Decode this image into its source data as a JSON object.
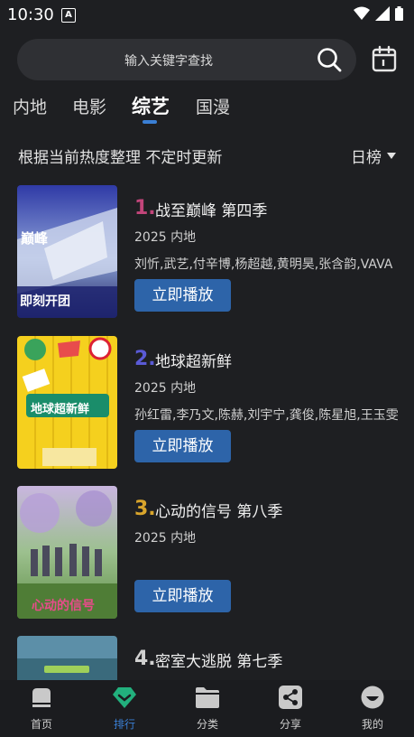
{
  "status_bar": {
    "time": "10:30",
    "notification_letter": "A"
  },
  "search": {
    "placeholder": "输入关键字查找"
  },
  "tabs": [
    {
      "label": "内地"
    },
    {
      "label": "电影"
    },
    {
      "label": "综艺",
      "active": true
    },
    {
      "label": "国漫"
    }
  ],
  "subheader": {
    "text": "根据当前热度整理 不定时更新",
    "ranking": "日榜"
  },
  "colors": {
    "accent": "#3a7fd5",
    "play_button": "#2d64a9",
    "rank1": "#c2457a",
    "rank2": "#5a5ad6",
    "rank3": "#d9a52c",
    "rank4": "#d0d0d0"
  },
  "items": [
    {
      "rank": "1.",
      "title": "战至巅峰 第四季",
      "meta": "2025  内地",
      "cast": "刘忻,武艺,付辛博,杨超越,黄明昊,张含韵,VAVA",
      "play": "立即播放",
      "poster_words": [
        "巅峰",
        "即刻开团"
      ]
    },
    {
      "rank": "2.",
      "title": "地球超新鲜",
      "meta": "2025  内地",
      "cast": "孙红雷,李乃文,陈赫,刘宇宁,龚俊,陈星旭,王玉雯",
      "play": "立即播放",
      "poster_words": [
        "地球超新鲜"
      ]
    },
    {
      "rank": "3.",
      "title": "心动的信号 第八季",
      "meta": "2025  内地",
      "cast": "",
      "play": "立即播放",
      "poster_words": [
        "心动的信号"
      ]
    },
    {
      "rank": "4.",
      "title": "密室大逃脱 第七季",
      "meta": "",
      "cast": "",
      "play": "",
      "poster_words": []
    }
  ],
  "bottom_nav": [
    {
      "label": "首页",
      "icon": "home-icon"
    },
    {
      "label": "排行",
      "icon": "ranking-icon",
      "active": true
    },
    {
      "label": "分类",
      "icon": "folder-icon"
    },
    {
      "label": "分享",
      "icon": "share-icon"
    },
    {
      "label": "我的",
      "icon": "profile-icon"
    }
  ]
}
